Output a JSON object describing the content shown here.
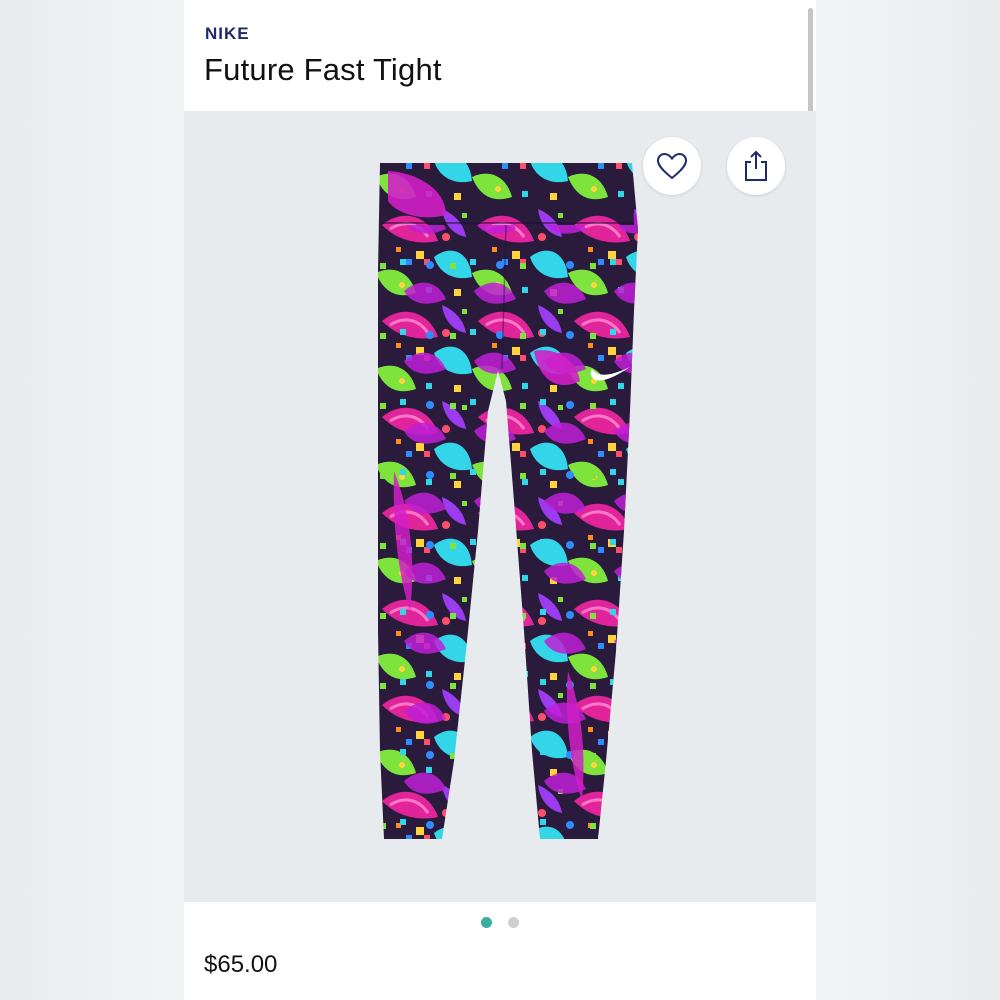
{
  "header": {
    "brand": "NIKE",
    "title": "Future Fast Tight"
  },
  "gallery": {
    "image_description_icon": "printed-leggings-image",
    "favorite_icon": "heart-icon",
    "share_icon": "share-icon",
    "active_dot_color": "#3aaea0",
    "inactive_dot_color": "#cfcfcf",
    "image_count": 2,
    "active_index": 1
  },
  "product": {
    "price": "$65.00"
  },
  "colors": {
    "brand": "#1d2b6b",
    "gallery_bg": "#e8ebee"
  }
}
